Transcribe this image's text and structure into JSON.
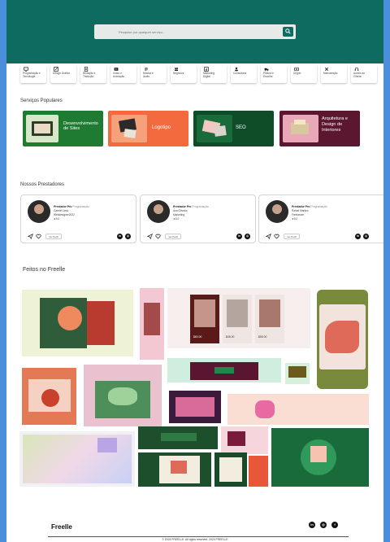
{
  "hero": {
    "search_placeholder": "Pesquise por qualquer serviço..."
  },
  "categories": [
    {
      "label": "Programação e\nTecnologia",
      "icon": "monitor-icon"
    },
    {
      "label": "Design Gráfico",
      "icon": "pen-icon"
    },
    {
      "label": "Redação e\nTradução",
      "icon": "document-icon"
    },
    {
      "label": "Vídeo e\nAnimação",
      "icon": "video-icon"
    },
    {
      "label": "Música e\nÁudio",
      "icon": "music-icon"
    },
    {
      "label": "Negócios",
      "icon": "people-icon"
    },
    {
      "label": "Marketing\nDigital",
      "icon": "chart-icon"
    },
    {
      "label": "Consultoria",
      "icon": "person-icon"
    },
    {
      "label": "Pintura e\nEscolha",
      "icon": "truck-icon"
    },
    {
      "label": "Crypto",
      "icon": "coin-icon"
    },
    {
      "label": "Manutenção",
      "icon": "tools-icon"
    },
    {
      "label": "Auxílio ao\nCliente",
      "icon": "headset-icon"
    }
  ],
  "services": {
    "title": "Serviços Populares",
    "items": [
      {
        "label": "Desenvolvimento\nde Sites",
        "bg": "#1f7a32"
      },
      {
        "label": "Logotipo",
        "bg": "#f26a3d"
      },
      {
        "label": "SEO",
        "bg": "#0f4d29"
      },
      {
        "label": "Arquitetura e\nDesign de\nInteriores",
        "bg": "#5b1630"
      }
    ]
  },
  "providers": {
    "title": "Nossos Prestadores",
    "items": [
      {
        "name": "Prestador Pro",
        "tag": "Programação",
        "lines": [
          "Gabriel Lima",
          "Webdesigner2022",
          "★5.0"
        ],
        "button": "Ver Perfil"
      },
      {
        "name": "Prestador Pro",
        "tag": "Programação",
        "lines": [
          "Ana Oliveira",
          "Marketing",
          "★5.0"
        ],
        "button": "Ver Perfil"
      },
      {
        "name": "Prestador Pro",
        "tag": "Programação",
        "lines": [
          "Rafael Martins",
          "Freelancer",
          "★5.0"
        ],
        "button": "Ver Perfil"
      }
    ]
  },
  "gallery": {
    "title": "Feitos no Freelle",
    "prices": [
      "$60.00",
      "$45.00",
      "$55.00"
    ]
  },
  "footer": {
    "brand": "Freelle",
    "copyright": "© 2024 FREELLE. All rights reserved. 2024 FREELLE"
  },
  "colors": {
    "primary": "#0d6b60",
    "frame": "#4a8fdc"
  }
}
